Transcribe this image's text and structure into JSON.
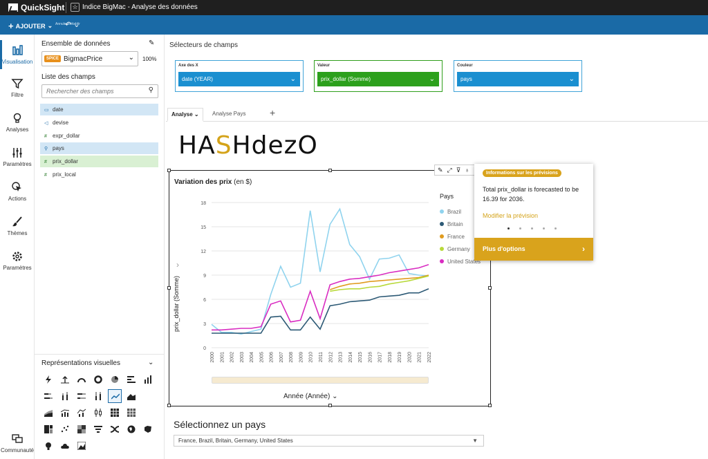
{
  "app": {
    "name": "QuickSight",
    "document_title": "Indice BigMac - Analyse des données",
    "add_label": "AJOUTER",
    "undo_small_label": "Annuler Rétablir"
  },
  "nav": [
    {
      "label": "Visualisation",
      "icon": "chart-icon"
    },
    {
      "label": "Filtre",
      "icon": "filter-icon"
    },
    {
      "label": "Analyses",
      "icon": "lightbulb-icon"
    },
    {
      "label": "Paramètres",
      "icon": "sliders-icon"
    },
    {
      "label": "Actions",
      "icon": "pointer-icon"
    },
    {
      "label": "Thèmes",
      "icon": "brush-icon"
    },
    {
      "label": "Paramètres",
      "icon": "gear-icon"
    },
    {
      "label": "Communauté",
      "icon": "chat-icon"
    }
  ],
  "data_panel": {
    "title": "Ensemble de données",
    "spice": "SPICE",
    "dataset": "BigmacPrice",
    "percent": "100%",
    "fields_title": "Liste des champs",
    "search_placeholder": "Rechercher des champs",
    "fields": [
      "date",
      "devise",
      "expr_dollar",
      "pays",
      "prix_dollar",
      "prix_local"
    ]
  },
  "vis_types": {
    "title": "Représentations visuelles"
  },
  "wells": {
    "title": "Sélecteurs de champs",
    "x": {
      "label": "Axe des X",
      "value": "date (YEAR)"
    },
    "value": {
      "label": "Valeur",
      "value": "prix_dollar (Somme)"
    },
    "color": {
      "label": "Couleur",
      "value": "pays"
    }
  },
  "tabs": {
    "active": "Analyse",
    "second": "Analyse Pays"
  },
  "brand": {
    "pre": "HA",
    "mid": "S",
    "post": "HdezO"
  },
  "visual": {
    "title": "Variation des prix",
    "title_unit": "(en $)"
  },
  "chart_data": {
    "type": "line",
    "title": "Variation des prix (en $)",
    "xlabel": "Année (Année)",
    "ylabel": "prix_dollar (Somme)",
    "legend_title": "Pays",
    "x": [
      2000,
      2001,
      2002,
      2003,
      2004,
      2005,
      2006,
      2007,
      2008,
      2009,
      2010,
      2011,
      2012,
      2013,
      2014,
      2015,
      2016,
      2017,
      2018,
      2019,
      2020,
      2021,
      2022
    ],
    "ylim": [
      0,
      18
    ],
    "yticks": [
      0,
      3,
      6,
      9,
      12,
      15,
      18
    ],
    "series": [
      {
        "name": "Brazil",
        "color": "#8fd3ee",
        "values": [
          2.9,
          1.9,
          1.9,
          1.7,
          2.0,
          2.3,
          6.6,
          10.1,
          7.5,
          8.0,
          17.0,
          9.4,
          15.3,
          17.2,
          12.8,
          11.3,
          8.5,
          11.0,
          11.1,
          11.5,
          9.2,
          9.0,
          8.9
        ]
      },
      {
        "name": "Britain",
        "color": "#2c5975",
        "values": [
          1.8,
          1.8,
          1.8,
          1.8,
          1.8,
          1.8,
          3.8,
          3.9,
          2.2,
          2.2,
          3.8,
          2.3,
          5.2,
          5.4,
          5.7,
          5.8,
          5.9,
          6.3,
          6.4,
          6.5,
          6.8,
          6.8,
          7.3
        ]
      },
      {
        "name": "France",
        "color": "#e09b1f",
        "values": [
          null,
          null,
          null,
          null,
          null,
          null,
          null,
          null,
          null,
          null,
          null,
          null,
          7.2,
          7.6,
          7.9,
          8.0,
          8.2,
          8.3,
          8.4,
          8.5,
          8.6,
          8.7,
          9.0
        ]
      },
      {
        "name": "Germany",
        "color": "#b8d93a",
        "values": [
          null,
          null,
          null,
          null,
          null,
          null,
          null,
          null,
          null,
          null,
          null,
          null,
          7.0,
          7.2,
          7.3,
          7.3,
          7.5,
          7.6,
          7.9,
          8.1,
          8.3,
          8.6,
          8.9
        ]
      },
      {
        "name": "United States",
        "color": "#d92cc1",
        "values": [
          2.2,
          2.2,
          2.3,
          2.4,
          2.4,
          2.6,
          5.4,
          5.8,
          3.2,
          3.4,
          7.0,
          3.6,
          7.8,
          8.2,
          8.5,
          8.6,
          8.8,
          9.0,
          9.3,
          9.5,
          9.7,
          9.9,
          10.3
        ]
      }
    ]
  },
  "insight": {
    "badge": "Informations sur les prévisions",
    "text": "Total prix_dollar is forecasted to be 16.39 for 2036.",
    "link": "Modifier la prévision",
    "more": "Plus d'options"
  },
  "country_filter": {
    "title": "Sélectionnez un pays",
    "value": "France, Brazil, Britain, Germany, United States"
  }
}
